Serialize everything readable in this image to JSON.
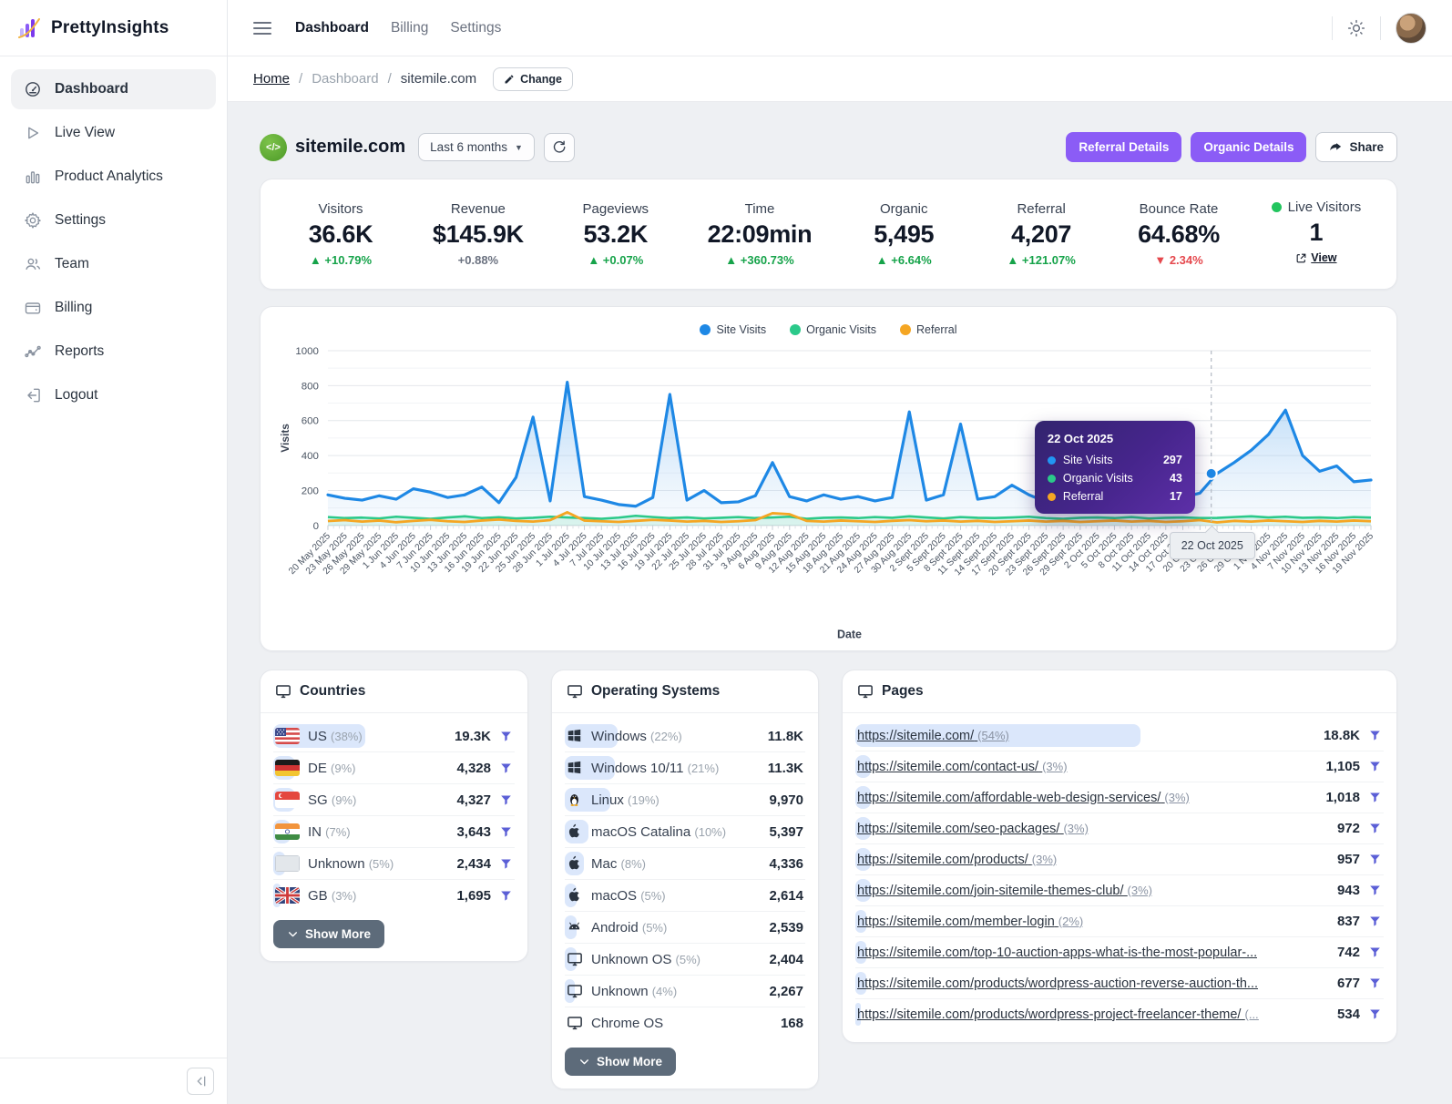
{
  "brand": {
    "name": "PrettyInsights"
  },
  "topnav": {
    "items": [
      "Dashboard",
      "Billing",
      "Settings"
    ],
    "active": "Dashboard"
  },
  "breadcrumb": {
    "home": "Home",
    "sep": "/",
    "section": "Dashboard",
    "site": "sitemile.com",
    "change_label": "Change"
  },
  "sidebar": {
    "items": [
      {
        "label": "Dashboard",
        "icon": "gauge-icon",
        "active": true
      },
      {
        "label": "Live View",
        "icon": "play-icon",
        "active": false
      },
      {
        "label": "Product Analytics",
        "icon": "bars-icon",
        "active": false
      },
      {
        "label": "Settings",
        "icon": "gear-icon",
        "active": false
      },
      {
        "label": "Team",
        "icon": "users-icon",
        "active": false
      },
      {
        "label": "Billing",
        "icon": "wallet-icon",
        "active": false
      },
      {
        "label": "Reports",
        "icon": "trend-icon",
        "active": false
      },
      {
        "label": "Logout",
        "icon": "logout-icon",
        "active": false
      }
    ]
  },
  "site_header": {
    "domain": "sitemile.com",
    "range_label": "Last 6 months",
    "referral_button": "Referral Details",
    "organic_button": "Organic Details",
    "share_button": "Share"
  },
  "stats": [
    {
      "label": "Visitors",
      "value": "36.6K",
      "delta": "+10.79%",
      "trend": "up"
    },
    {
      "label": "Revenue",
      "value": "$145.9K",
      "delta": "+0.88%",
      "trend": "flat"
    },
    {
      "label": "Pageviews",
      "value": "53.2K",
      "delta": "+0.07%",
      "trend": "up"
    },
    {
      "label": "Time",
      "value": "22:09min",
      "delta": "+360.73%",
      "trend": "up"
    },
    {
      "label": "Organic",
      "value": "5,495",
      "delta": "+6.64%",
      "trend": "up"
    },
    {
      "label": "Referral",
      "value": "4,207",
      "delta": "+121.07%",
      "trend": "up"
    },
    {
      "label": "Bounce Rate",
      "value": "64.68%",
      "delta": "2.34%",
      "trend": "down"
    },
    {
      "label": "Live Visitors",
      "value": "1",
      "live": true,
      "view_label": "View"
    }
  ],
  "chart_data": {
    "type": "area",
    "xlabel": "Date",
    "ylabel": "Visits",
    "ylim": [
      0,
      1000
    ],
    "yticks": [
      0,
      200,
      400,
      600,
      800,
      1000
    ],
    "legend_position": "top",
    "x": [
      "20 May 2025",
      "23 May 2025",
      "26 May 2025",
      "29 May 2025",
      "1 Jun 2025",
      "4 Jun 2025",
      "7 Jun 2025",
      "10 Jun 2025",
      "13 Jun 2025",
      "16 Jun 2025",
      "19 Jun 2025",
      "22 Jun 2025",
      "25 Jun 2025",
      "28 Jun 2025",
      "1 Jul 2025",
      "4 Jul 2025",
      "7 Jul 2025",
      "10 Jul 2025",
      "13 Jul 2025",
      "16 Jul 2025",
      "19 Jul 2025",
      "22 Jul 2025",
      "25 Jul 2025",
      "28 Jul 2025",
      "31 Jul 2025",
      "3 Aug 2025",
      "6 Aug 2025",
      "9 Aug 2025",
      "12 Aug 2025",
      "15 Aug 2025",
      "18 Aug 2025",
      "21 Aug 2025",
      "24 Aug 2025",
      "27 Aug 2025",
      "30 Aug 2025",
      "2 Sept 2025",
      "5 Sept 2025",
      "8 Sept 2025",
      "11 Sept 2025",
      "14 Sept 2025",
      "17 Sept 2025",
      "20 Sept 2025",
      "23 Sept 2025",
      "26 Sept 2025",
      "29 Sept 2025",
      "2 Oct 2025",
      "5 Oct 2025",
      "8 Oct 2025",
      "11 Oct 2025",
      "14 Oct 2025",
      "17 Oct 2025",
      "20 Oct 2025",
      "23 Oct 2025",
      "26 Oct 2025",
      "29 Oct 2025",
      "1 Nov 2025",
      "4 Nov 2025",
      "7 Nov 2025",
      "10 Nov 2025",
      "13 Nov 2025",
      "16 Nov 2025",
      "19 Nov 2025"
    ],
    "series": [
      {
        "name": "Site Visits",
        "color": "#1e88e5",
        "values": [
          175,
          155,
          145,
          170,
          150,
          210,
          190,
          160,
          175,
          220,
          130,
          275,
          620,
          140,
          820,
          165,
          145,
          120,
          110,
          160,
          750,
          145,
          200,
          130,
          135,
          170,
          360,
          165,
          140,
          175,
          150,
          165,
          140,
          160,
          650,
          145,
          175,
          580,
          150,
          165,
          230,
          175,
          135,
          160,
          140,
          170,
          155,
          130,
          175,
          145,
          160,
          185,
          297,
          360,
          430,
          520,
          660,
          400,
          310,
          340,
          250,
          260
        ]
      },
      {
        "name": "Organic Visits",
        "color": "#2bc98a",
        "values": [
          48,
          42,
          45,
          40,
          50,
          44,
          38,
          46,
          52,
          42,
          47,
          40,
          44,
          50,
          46,
          42,
          38,
          45,
          55,
          48,
          42,
          46,
          40,
          44,
          48,
          42,
          46,
          50,
          38,
          44,
          46,
          42,
          48,
          44,
          52,
          46,
          40,
          48,
          44,
          42,
          46,
          50,
          42,
          38,
          44,
          46,
          42,
          48,
          40,
          44,
          46,
          42,
          43,
          48,
          52,
          46,
          50,
          44,
          46,
          42,
          48,
          45
        ]
      },
      {
        "name": "Referral",
        "color": "#f5a623",
        "values": [
          25,
          30,
          22,
          28,
          18,
          26,
          32,
          24,
          20,
          28,
          34,
          26,
          22,
          30,
          75,
          28,
          24,
          20,
          26,
          32,
          28,
          22,
          26,
          20,
          24,
          30,
          70,
          64,
          26,
          22,
          28,
          24,
          20,
          26,
          30,
          24,
          28,
          22,
          26,
          20,
          24,
          28,
          22,
          26,
          20,
          24,
          28,
          22,
          26,
          20,
          24,
          30,
          17,
          26,
          22,
          28,
          24,
          20,
          26,
          22,
          28,
          24
        ]
      }
    ],
    "tooltip": {
      "date": "22 Oct 2025",
      "x_index": 51.66,
      "rows": [
        {
          "name": "Site Visits",
          "value": "297",
          "color": "#2196f3"
        },
        {
          "name": "Organic Visits",
          "value": "43",
          "color": "#2bc98a"
        },
        {
          "name": "Referral",
          "value": "17",
          "color": "#f5a623"
        }
      ]
    },
    "axis_tooltip": "22 Oct 2025"
  },
  "panels": {
    "countries": {
      "title": "Countries",
      "show_more": "Show More",
      "rows": [
        {
          "flag": "us",
          "label": "US",
          "pct": "(38%)",
          "pct_num": 38,
          "value": "19.3K"
        },
        {
          "flag": "de",
          "label": "DE",
          "pct": "(9%)",
          "pct_num": 9,
          "value": "4,328"
        },
        {
          "flag": "sg",
          "label": "SG",
          "pct": "(9%)",
          "pct_num": 9,
          "value": "4,327"
        },
        {
          "flag": "in",
          "label": "IN",
          "pct": "(7%)",
          "pct_num": 7,
          "value": "3,643"
        },
        {
          "flag": "unknown",
          "label": "Unknown",
          "pct": "(5%)",
          "pct_num": 5,
          "value": "2,434"
        },
        {
          "flag": "gb",
          "label": "GB",
          "pct": "(3%)",
          "pct_num": 3,
          "value": "1,695"
        }
      ]
    },
    "os": {
      "title": "Operating Systems",
      "show_more": "Show More",
      "rows": [
        {
          "icon": "windows-icon",
          "label": "Windows",
          "pct": "(22%)",
          "pct_num": 22,
          "value": "11.8K"
        },
        {
          "icon": "windows-icon",
          "label": "Windows 10/11",
          "pct": "(21%)",
          "pct_num": 21,
          "value": "11.3K"
        },
        {
          "icon": "linux-icon",
          "label": "Linux",
          "pct": "(19%)",
          "pct_num": 19,
          "value": "9,970"
        },
        {
          "icon": "apple-icon",
          "label": "macOS Catalina",
          "pct": "(10%)",
          "pct_num": 10,
          "value": "5,397"
        },
        {
          "icon": "apple-icon",
          "label": "Mac",
          "pct": "(8%)",
          "pct_num": 8,
          "value": "4,336"
        },
        {
          "icon": "apple-icon",
          "label": "macOS",
          "pct": "(5%)",
          "pct_num": 5,
          "value": "2,614"
        },
        {
          "icon": "android-icon",
          "label": "Android",
          "pct": "(5%)",
          "pct_num": 5,
          "value": "2,539"
        },
        {
          "icon": "monitor-icon",
          "label": "Unknown OS",
          "pct": "(5%)",
          "pct_num": 5,
          "value": "2,404"
        },
        {
          "icon": "monitor-icon",
          "label": "Unknown",
          "pct": "(4%)",
          "pct_num": 4,
          "value": "2,267"
        },
        {
          "icon": "monitor-icon",
          "label": "Chrome OS",
          "pct": "",
          "pct_num": 0,
          "value": "168"
        }
      ]
    },
    "pages": {
      "title": "Pages",
      "rows": [
        {
          "url": "https://sitemile.com/",
          "pct": "(54%)",
          "pct_num": 54,
          "value": "18.8K"
        },
        {
          "url": "https://sitemile.com/contact-us/",
          "pct": "(3%)",
          "pct_num": 3,
          "value": "1,105"
        },
        {
          "url": "https://sitemile.com/affordable-web-design-services/",
          "pct": "(3%)",
          "pct_num": 3,
          "value": "1,018"
        },
        {
          "url": "https://sitemile.com/seo-packages/",
          "pct": "(3%)",
          "pct_num": 3,
          "value": "972"
        },
        {
          "url": "https://sitemile.com/products/",
          "pct": "(3%)",
          "pct_num": 3,
          "value": "957"
        },
        {
          "url": "https://sitemile.com/join-sitemile-themes-club/",
          "pct": "(3%)",
          "pct_num": 3,
          "value": "943"
        },
        {
          "url": "https://sitemile.com/member-login",
          "pct": "(2%)",
          "pct_num": 2,
          "value": "837"
        },
        {
          "url": "https://sitemile.com/top-10-auction-apps-what-is-the-most-popular-...",
          "pct": "",
          "pct_num": 2,
          "value": "742"
        },
        {
          "url": "https://sitemile.com/products/wordpress-auction-reverse-auction-th...",
          "pct": "",
          "pct_num": 2,
          "value": "677"
        },
        {
          "url": "https://sitemile.com/products/wordpress-project-freelancer-theme/",
          "pct": "(...",
          "pct_num": 1,
          "value": "534"
        }
      ]
    }
  },
  "colors": {
    "accent": "#8b5cf6",
    "site_visits": "#1e88e5",
    "organic_visits": "#2bc98a",
    "referral": "#f5a623",
    "live": "#22c55e",
    "up": "#16a34a",
    "down": "#e5484d",
    "funnel": "#5b5fd6"
  }
}
